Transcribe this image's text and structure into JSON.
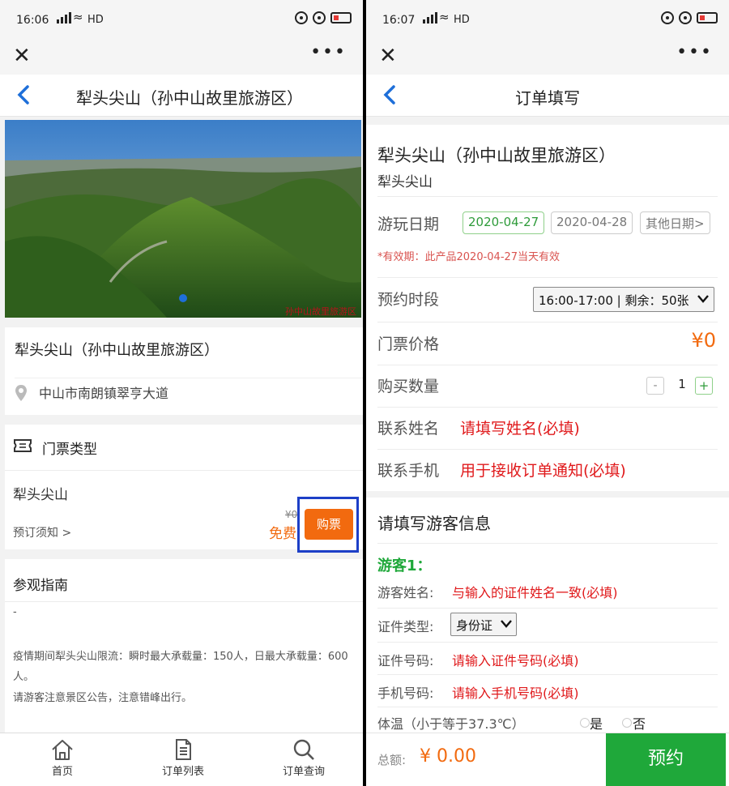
{
  "status_left": {
    "time": "16:06",
    "net": "HD"
  },
  "status_right": {
    "time": "16:07",
    "net": "HD"
  },
  "left": {
    "nav_title": "犁头尖山（孙中山故里旅游区）",
    "hero_dot": "●",
    "hero_watermark": "孙中山故里旅游区",
    "scenic_name": "犁头尖山（孙中山故里旅游区）",
    "address": "中山市南朗镇翠亨大道",
    "ticket_section_title": "门票类型",
    "ticket_name": "犁头尖山",
    "ticket_notice": "预订须知 >",
    "orig_price": "¥0",
    "free_label": "免费",
    "buy_button": "购票",
    "guide_title": "参观指南",
    "guide_dash": "-",
    "guide_text1": "疫情期间犁头尖山限流：瞬时最大承载量：150人，日最大承载量：600人。",
    "guide_text2": "请游客注意景区公告，注意错峰出行。",
    "footer": [
      {
        "label": "首页",
        "icon": "home-icon"
      },
      {
        "label": "订单列表",
        "icon": "document-icon"
      },
      {
        "label": "订单查询",
        "icon": "search-icon"
      }
    ]
  },
  "right": {
    "nav_title": "订单填写",
    "product_name": "犁头尖山（孙中山故里旅游区）",
    "product_sub": "犁头尖山",
    "date_label": "游玩日期",
    "dates": [
      "2020-04-27",
      "2020-04-28",
      "其他日期>"
    ],
    "validity": "*有效期：此产品2020-04-27当天有效",
    "slot_label": "预约时段",
    "slot_value": "16:00-17:00 | 剩余：50张",
    "price_label": "门票价格",
    "price_value": "¥0",
    "qty_label": "购买数量",
    "qty_minus": "-",
    "qty_value": "1",
    "qty_plus": "+",
    "contact_name_label": "联系姓名",
    "contact_name_placeholder": "请填写姓名(必填)",
    "contact_phone_label": "联系手机",
    "contact_phone_placeholder": "用于接收订单通知(必填)",
    "visitor_section_title": "请填写游客信息",
    "visitor_heading": "游客1：",
    "visitor_name_label": "游客姓名:",
    "visitor_name_placeholder": "与输入的证件姓名一致(必填)",
    "id_type_label": "证件类型:",
    "id_type_value": "身份证",
    "id_no_label": "证件号码:",
    "id_no_placeholder": "请输入证件号码(必填)",
    "phone_label": "手机号码:",
    "phone_placeholder": "请输入手机号码(必填)",
    "temp_label": "体温（小于等于37.3℃）",
    "temp_yes": "是",
    "temp_no": "否",
    "total_label": "总额:",
    "total_value": "¥ 0.00",
    "submit_button": "预约"
  },
  "colors": {
    "accent_orange": "#f26a0f",
    "submit_green": "#1fa83a",
    "link_blue": "#1e6fd9",
    "highlight_box": "#1d3fc7",
    "required_red": "#e0191b"
  }
}
